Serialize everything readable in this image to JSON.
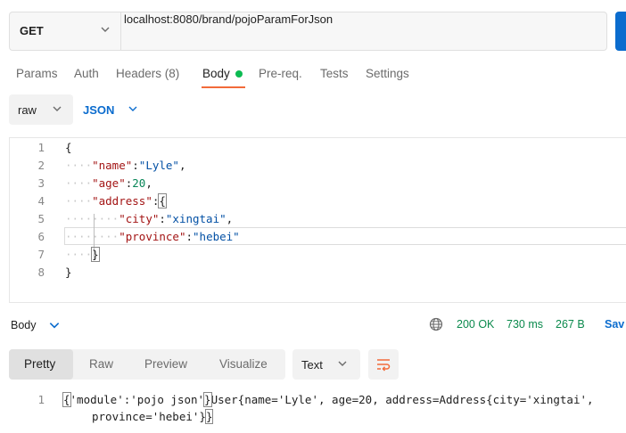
{
  "request": {
    "method": "GET",
    "url": "localhost:8080/brand/pojoParamForJson"
  },
  "tabs": [
    "Params",
    "Auth",
    "Headers (8)",
    "Body",
    "Pre-req.",
    "Tests",
    "Settings"
  ],
  "active_tab": "Body",
  "body_type": {
    "mode": "raw",
    "language": "JSON"
  },
  "editor": {
    "line_numbers": [
      "1",
      "2",
      "3",
      "4",
      "5",
      "6",
      "7",
      "8"
    ]
  },
  "json_body": {
    "open_brace": "{",
    "close_brace": "}",
    "name_key": "\"name\"",
    "name_val": "\"Lyle\"",
    "age_key": "\"age\"",
    "age_val": "20",
    "address_key": "\"address\"",
    "city_key": "\"city\"",
    "city_val": "\"xingtai\"",
    "province_key": "\"province\"",
    "province_val": "\"hebei\""
  },
  "response": {
    "section_label": "Body",
    "status": "200 OK",
    "time": "730 ms",
    "size": "267 B",
    "save_label": "Sav",
    "view_tabs": [
      "Pretty",
      "Raw",
      "Preview",
      "Visualize"
    ],
    "active_view": "Pretty",
    "format": "Text",
    "line_number": "1",
    "line1": {
      "open": "{",
      "part1": "'module':'pojo json'",
      "close": "}",
      "part2": "User{name='Lyle', age=20, address=Address{city='xingtai',"
    },
    "line2": {
      "part1": "province='hebei'}",
      "close": "}"
    }
  },
  "colors": {
    "accent": "#0b6cce",
    "tab_underline": "#f26b3a",
    "status_green": "#0b8a4d",
    "json_key": "#a31515",
    "json_string": "#0451a5",
    "json_number": "#098658"
  }
}
